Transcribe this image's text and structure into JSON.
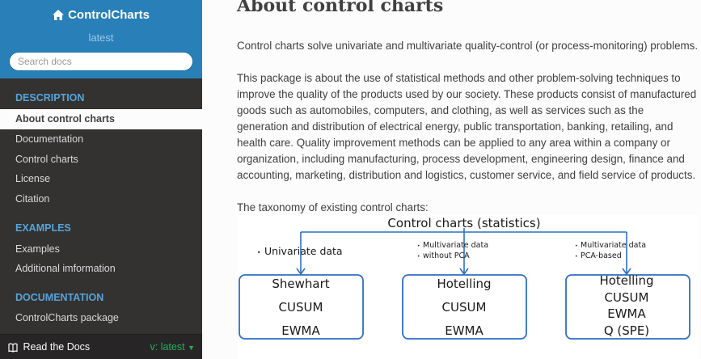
{
  "sidebar": {
    "project": "ControlCharts",
    "version": "latest",
    "search_placeholder": "Search docs",
    "sections": [
      {
        "caption": "DESCRIPTION",
        "items": [
          "About control charts",
          "Documentation",
          "Control charts",
          "License",
          "Citation"
        ]
      },
      {
        "caption": "EXAMPLES",
        "items": [
          "Examples",
          "Additional imformation"
        ]
      },
      {
        "caption": "DOCUMENTATION",
        "items": [
          "ControlCharts package"
        ]
      }
    ],
    "footer": {
      "label": "Read the Docs",
      "version": "v: latest"
    }
  },
  "page": {
    "title": "About control charts",
    "para1": "Control charts solve univariate and multivariate quality-control (or process-monitoring) problems.",
    "para2": "This package is about the use of statistical methods and other problem-solving techniques to improve the quality of the products used by our society. These products consist of manufactured goods such as automobiles, computers, and clothing, as well as services such as the generation and distribution of electrical energy, public transportation, banking, retailing, and health care. Quality improvement methods can be applied to any area within a company or organization, including manufacturing, process development, engineering design, finance and accounting, marketing, distribution and logistics, customer service, and field service of products.",
    "para3": "The taxonomy of existing control charts:"
  },
  "diagram": {
    "root": "Control charts (statistics)",
    "branches": [
      {
        "notes": [
          "Univariate data"
        ],
        "methods": [
          "Shewhart",
          "CUSUM",
          "EWMA"
        ]
      },
      {
        "notes": [
          "Multivariate data",
          "without PCA"
        ],
        "methods": [
          "Hotelling",
          "CUSUM",
          "EWMA"
        ]
      },
      {
        "notes": [
          "Multivariate data",
          "PCA-based"
        ],
        "methods": [
          "Hotelling",
          "CUSUM",
          "EWMA",
          "Q (SPE)"
        ]
      }
    ],
    "line_color": "#2e6fc4"
  }
}
